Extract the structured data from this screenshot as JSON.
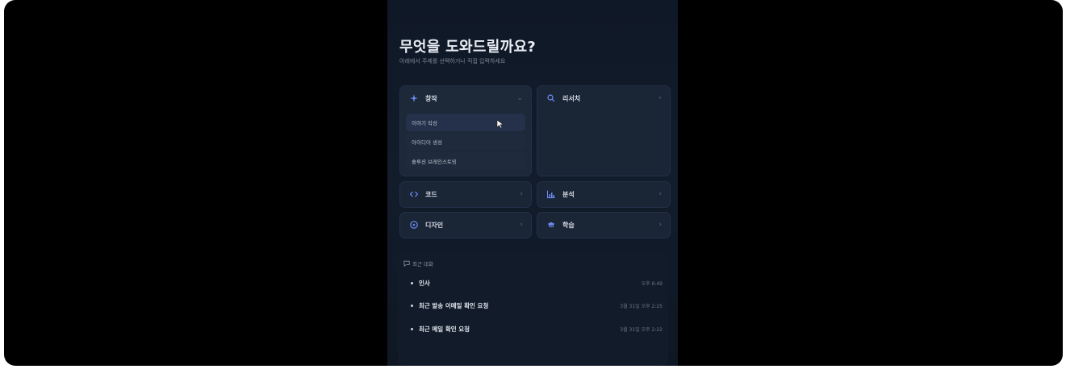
{
  "header": {
    "title": "무엇을 도와드릴까요?",
    "subtitle": "아래에서 주제를 선택하거나 직접 입력하세요"
  },
  "cards": {
    "create": {
      "label": "창작",
      "icon": "sparkle-icon",
      "chevron": "⌄",
      "options": [
        "이야기 작성",
        "아이디어 생성",
        "솔루션 브레인스토밍"
      ]
    },
    "research": {
      "label": "리서치",
      "icon": "search-icon",
      "chevron": "›"
    },
    "code": {
      "label": "코드",
      "icon": "code-icon",
      "chevron": "›"
    },
    "analysis": {
      "label": "분석",
      "icon": "chart-icon",
      "chevron": "›"
    },
    "design": {
      "label": "디자인",
      "icon": "palette-icon",
      "chevron": "›"
    },
    "learn": {
      "label": "학습",
      "icon": "graduation-cap-icon",
      "chevron": "›"
    }
  },
  "recent": {
    "heading": "최근 대화",
    "items": [
      {
        "title": "인사",
        "time": "오후 6:49"
      },
      {
        "title": "최근 발송 이메일 확인 요청",
        "time": "3월 31일 오후 2:25"
      },
      {
        "title": "최근 메일 확인 요청",
        "time": "3월 31일 오후 2:22"
      }
    ]
  },
  "colors": {
    "background": "#000000",
    "panel": "#111b29",
    "card": "#1a2536",
    "accent": "#5b8cff"
  }
}
